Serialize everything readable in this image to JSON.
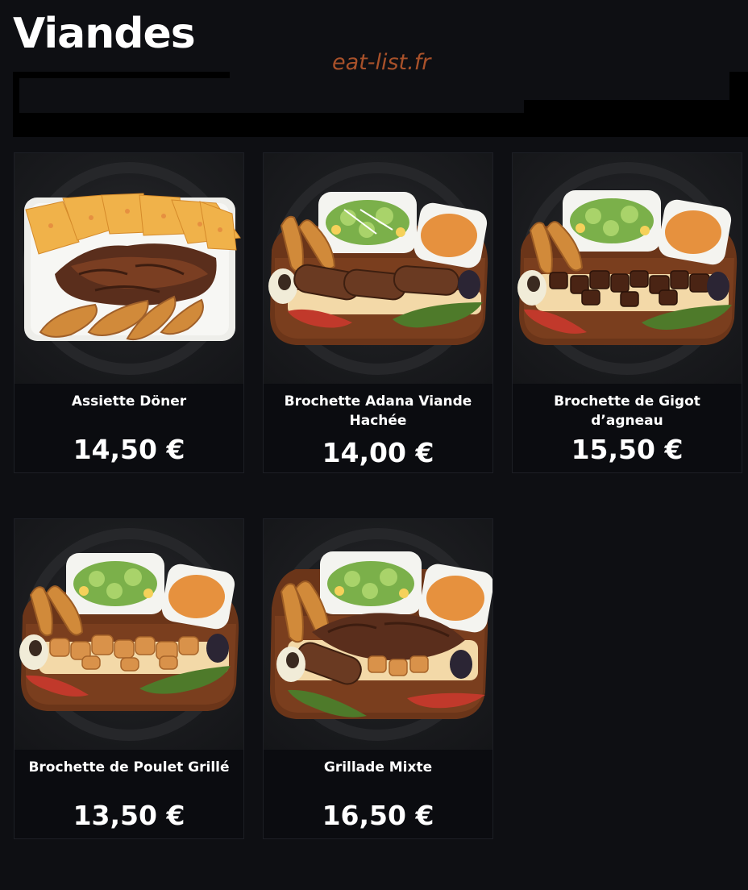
{
  "page": {
    "title": "Viandes",
    "watermark": "eat-list.fr"
  },
  "items": [
    {
      "name": "Assiette Döner",
      "price": "14,50 €",
      "photo_icon": "doner-plate-photo"
    },
    {
      "name": "Brochette Adana Viande Hachée",
      "price": "14,00 €",
      "photo_icon": "adana-skewer-board-photo"
    },
    {
      "name": "Brochette de Gigot d’agneau",
      "price": "15,50 €",
      "photo_icon": "lamb-skewer-board-photo"
    },
    {
      "name": "Brochette de Poulet Grillé",
      "price": "13,50 €",
      "photo_icon": "chicken-skewer-board-photo"
    },
    {
      "name": "Grillade Mixte",
      "price": "16,50 €",
      "photo_icon": "mixed-grill-board-photo"
    }
  ],
  "colors": {
    "background": "#0e0f13",
    "card": "#0b0c10",
    "watermark": "#a8512a"
  }
}
